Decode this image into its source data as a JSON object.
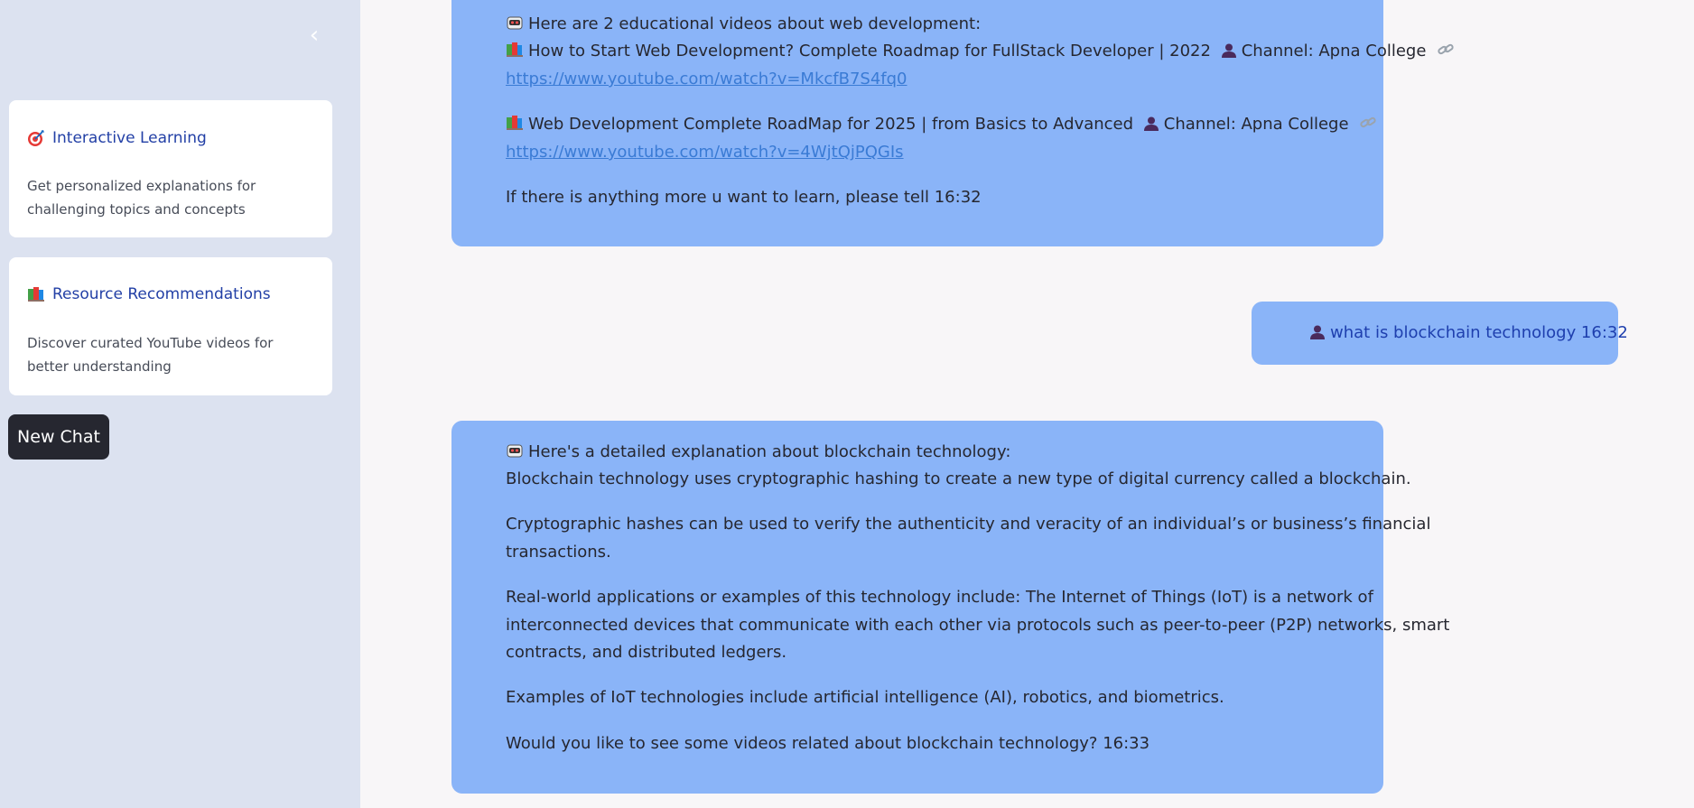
{
  "sidebar": {
    "collapse_glyph": "‹",
    "cards": [
      {
        "icon": "target-icon",
        "title": "Interactive Learning",
        "desc": "Get personalized explanations for challenging topics and concepts"
      },
      {
        "icon": "books-icon",
        "title": "Resource Recommendations",
        "desc": "Discover curated YouTube videos for better understanding"
      }
    ],
    "new_chat_label": "New Chat"
  },
  "chat": {
    "msg1": {
      "intro": "Here are 2 educational videos about web development:",
      "videos": [
        {
          "title": "How to Start Web Development? Complete Roadmap for FullStack Developer | 2022",
          "channel": "Channel: Apna College",
          "url": "https://www.youtube.com/watch?v=MkcfB7S4fq0"
        },
        {
          "title": "Web Development Complete RoadMap for 2025 | from Basics to Advanced",
          "channel": "Channel: Apna College",
          "url": "https://www.youtube.com/watch?v=4WjtQjPQGIs"
        }
      ],
      "outro": "If there is anything more u want to learn, please tell 16:32"
    },
    "user_msg": "what is blockchain technology 16:32",
    "msg2": {
      "intro": "Here's a detailed explanation about blockchain technology:",
      "p1": "Blockchain technology uses cryptographic hashing to create a new type of digital currency called a blockchain.",
      "p2_l1": "Cryptographic hashes can be used to verify the authenticity and veracity of an individual’s or business’s financial",
      "p2_l2": "transactions.",
      "p3_l1": "Real-world applications or examples of this technology include: The Internet of Things (IoT) is a network of",
      "p3_l2": "interconnected devices that communicate with each other via protocols such as peer-to-peer (P2P) networks, smart",
      "p3_l3": "contracts, and distributed ledgers.",
      "p4": "Examples of IoT technologies include artificial intelligence (AI), robotics, and biometrics.",
      "p5": "Would you like to see some videos related about blockchain technology? 16:33"
    }
  },
  "colors": {
    "sidebar_bg": "#dce2f0",
    "bubble_bg": "#8ab4f8",
    "accent": "#2340a6",
    "button_bg": "#262730"
  }
}
